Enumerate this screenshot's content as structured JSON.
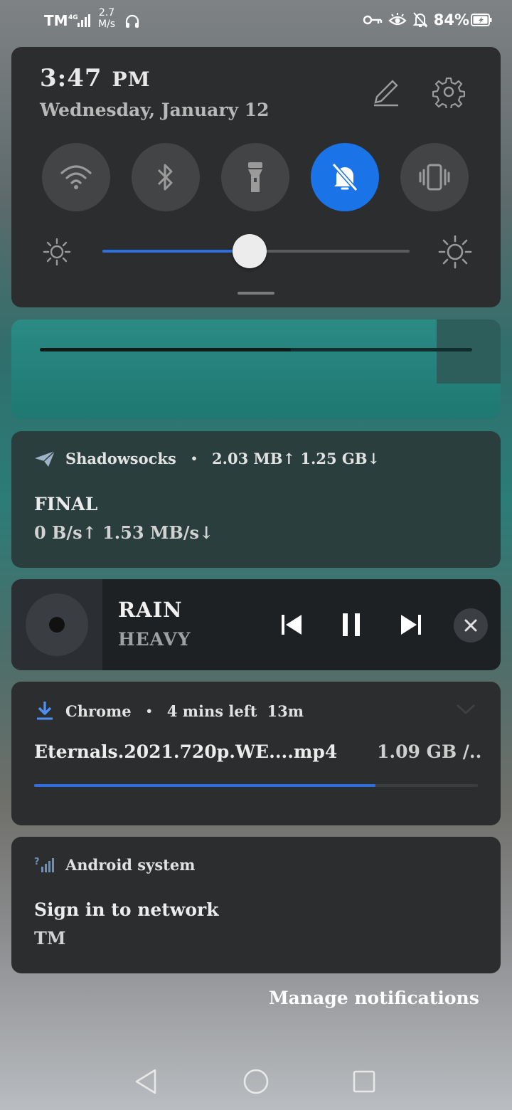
{
  "status_bar": {
    "carrier": "TM",
    "network_type": "4G",
    "speed_value": "2.7",
    "speed_unit": "M/s",
    "battery": "84%"
  },
  "quick_settings": {
    "time": "3:47",
    "ampm": "PM",
    "date": "Wednesday, January 12",
    "tiles": [
      {
        "icon": "wifi-icon",
        "active": false
      },
      {
        "icon": "bluetooth-icon",
        "active": false
      },
      {
        "icon": "flashlight-icon",
        "active": false
      },
      {
        "icon": "do-not-disturb-bell-icon",
        "active": true
      },
      {
        "icon": "vibrate-icon",
        "active": false
      }
    ],
    "brightness_level": 0.48
  },
  "video_player": {
    "progress": 0.58
  },
  "notifications": {
    "shadowsocks": {
      "app": "Shadowsocks",
      "meta": "2.03 MB↑ 1.25 GB↓",
      "title": "FINAL",
      "body": "0 B/s↑  1.53 MB/s↓"
    },
    "media": {
      "title": "RAIN",
      "artist": "HEAVY"
    },
    "chrome": {
      "app": "Chrome",
      "meta_left": "4 mins left",
      "meta_right": "13m",
      "file": "Eternals.2021.720p.WE....mp4",
      "size": "1.09 GB /..",
      "progress": 0.77
    },
    "android": {
      "app": "Android system",
      "title": "Sign in to network",
      "body": "TM"
    }
  },
  "manage_label": "Manage notifications",
  "colors": {
    "accent": "#1b73e8",
    "panel": "#2c2d2f"
  }
}
